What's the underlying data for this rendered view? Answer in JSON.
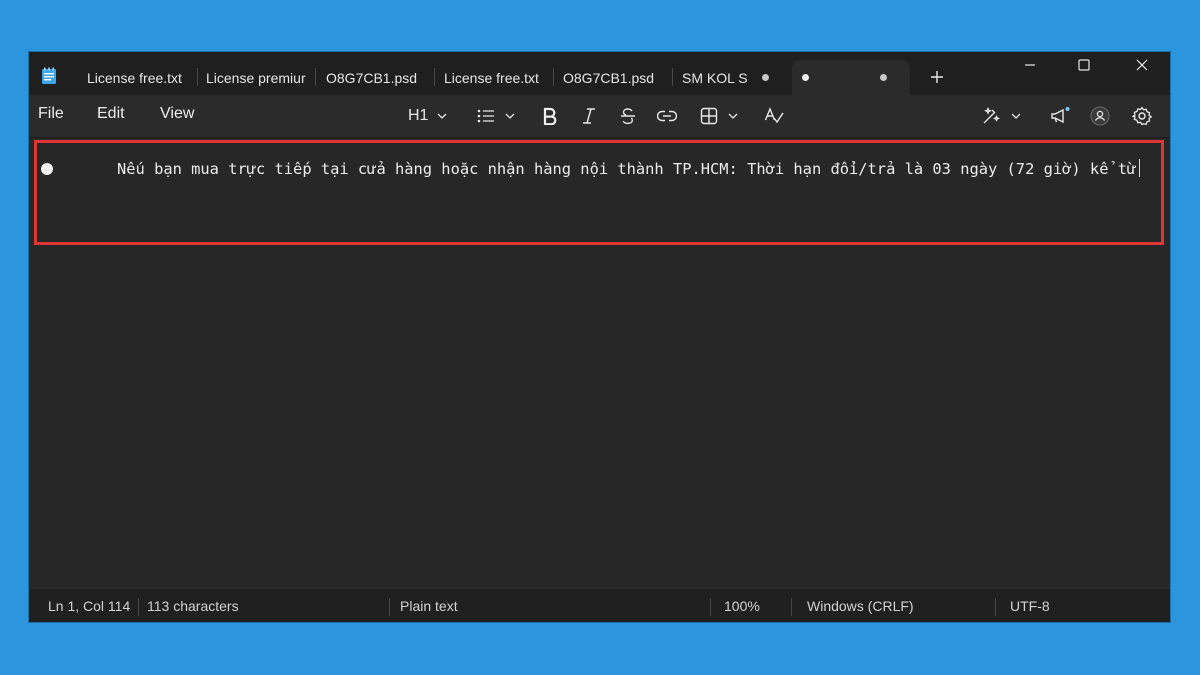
{
  "tabs": [
    {
      "label": "License free.txt"
    },
    {
      "label": "License premiur"
    },
    {
      "label": "O8G7CB1.psd"
    },
    {
      "label": "License free.txt"
    },
    {
      "label": "O8G7CB1.psd"
    },
    {
      "label": "SM KOL S"
    },
    {
      "label": ""
    }
  ],
  "menu": {
    "file": "File",
    "edit": "Edit",
    "view": "View"
  },
  "toolbar": {
    "heading": "H1"
  },
  "editor": {
    "line1": "Nếu bạn mua trực tiếp tại cửa hàng hoặc nhận hàng nội thành TP.HCM: Thời hạn đổi/trả là 03 ngày (72 giờ) kể từ"
  },
  "status": {
    "position": "Ln 1, Col 114",
    "characters": "113 characters",
    "format": "Plain text",
    "zoom": "100%",
    "line_ending": "Windows (CRLF)",
    "encoding": "UTF-8"
  },
  "colors": {
    "desktop": "#2b96dd",
    "window_bg": "#272727",
    "highlight": "#e03535"
  },
  "icons": [
    "notepad-app-icon",
    "plus-icon",
    "minimize-icon",
    "maximize-icon",
    "close-icon",
    "chevron-down-icon",
    "list-icon",
    "bold-icon",
    "italic-icon",
    "strikethrough-icon",
    "link-icon",
    "table-icon",
    "spellcheck-icon",
    "copilot-icon",
    "announcement-icon",
    "account-icon",
    "gear-icon"
  ]
}
